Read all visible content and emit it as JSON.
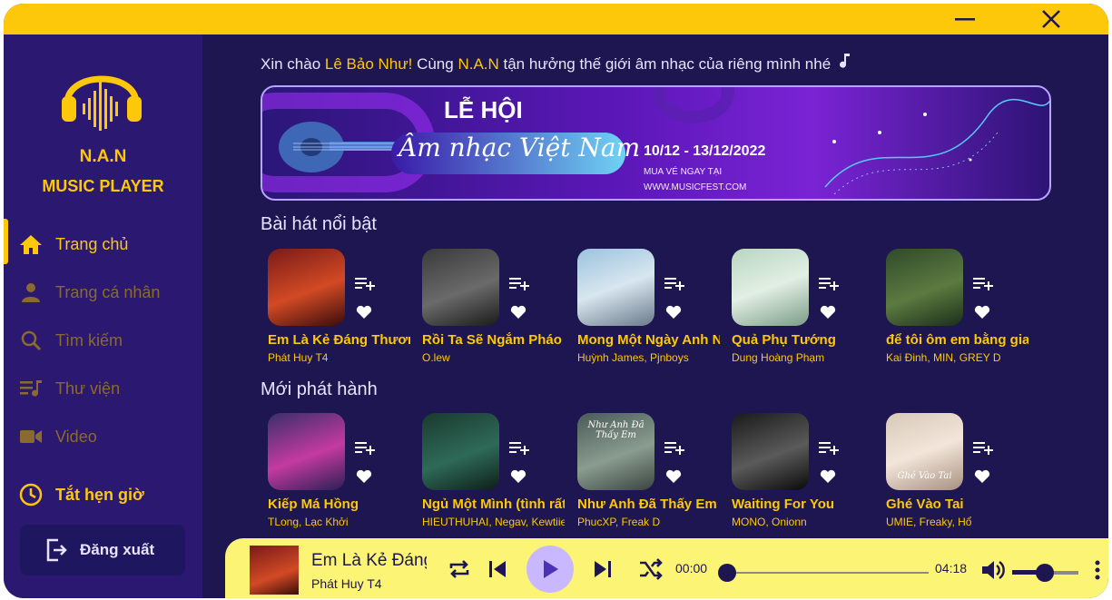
{
  "app": {
    "brand_line1": "N.A.N",
    "brand_line2": "MUSIC PLAYER"
  },
  "sidebar": {
    "items": [
      {
        "label": "Trang chủ",
        "icon": "home-icon",
        "active": true
      },
      {
        "label": "Trang cá nhân",
        "icon": "person-icon"
      },
      {
        "label": "Tìm kiếm",
        "icon": "search-icon"
      },
      {
        "label": "Thư viện",
        "icon": "library-icon"
      },
      {
        "label": "Video",
        "icon": "video-icon"
      },
      {
        "label": "Tắt hẹn giờ",
        "icon": "clock-icon"
      }
    ],
    "logout_label": "Đăng xuất"
  },
  "greeting": {
    "prefix": "Xin chào ",
    "name": "Lê Bảo Như!",
    "middle": "  Cùng ",
    "brand": "N.A.N",
    "suffix": " tận hưởng thế giới âm nhạc của riêng mình nhé"
  },
  "banner": {
    "title1": "LỄ HỘI",
    "title2": "Âm nhạc Việt Nam",
    "date": "10/12 - 13/12/2022",
    "buy": "MUA VÉ NGAY TẠI",
    "site": "WWW.MUSICFEST.COM"
  },
  "featured": {
    "title": "Bài hát nổi bật",
    "songs": [
      {
        "title": "Em Là Kẻ Đáng Thương",
        "artist": "Phát Huy T4"
      },
      {
        "title": "Rồi Ta Sẽ Ngắm Pháo Hoa",
        "artist": "O.lew"
      },
      {
        "title": "Mong Một Ngày Anh Nhớ Đến Em",
        "artist": "Huỳnh James, Pjnboys"
      },
      {
        "title": "Quả Phụ Tướng",
        "artist": "Dung Hoàng Phạm"
      },
      {
        "title": "để tôi ôm em bằng giai điệu này",
        "artist": "Kai Đinh, MIN, GREY D"
      }
    ]
  },
  "new_releases": {
    "title": "Mới phát hành",
    "songs": [
      {
        "title": "Kiếp Má Hồng",
        "artist": "TLong, Lạc Khởi"
      },
      {
        "title": "Ngủ Một Mình (tình rất tình)",
        "artist": "HIEUTHUHAI, Negav, Kewtiie"
      },
      {
        "title": "Như Anh Đã Thấy Em",
        "artist": "PhucXP, Freak D"
      },
      {
        "title": "Waiting For You",
        "artist": "MONO, Onionn"
      },
      {
        "title": "Ghé Vào Tai",
        "artist": "UMIE, Freaky, Hổ"
      }
    ]
  },
  "art_texts": [
    "Như Anh Đã Thấy Em",
    "Ghé Vào Tai"
  ],
  "player": {
    "title": "Em Là Kẻ Đáng Thương",
    "artist": "Phát Huy T4",
    "current_time": "00:00",
    "duration": "04:18",
    "progress": 0.0,
    "volume": 0.5
  },
  "colors": {
    "accent": "#fdc809",
    "background": "#1d1650",
    "sidebar": "#2b1870",
    "player_bg": "#fcf475"
  }
}
